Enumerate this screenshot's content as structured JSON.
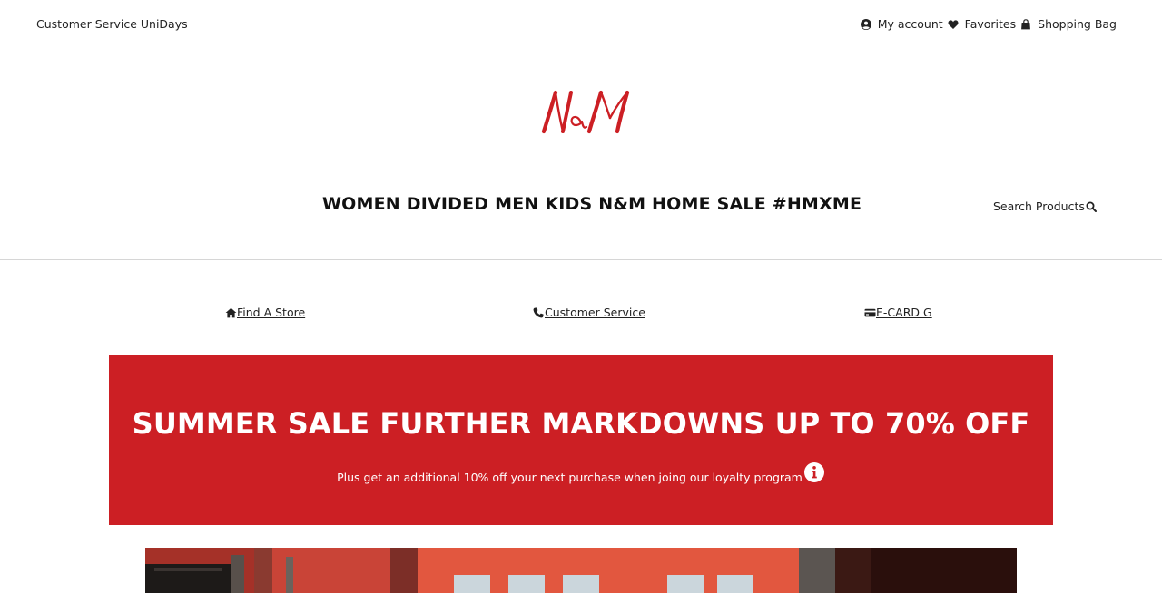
{
  "topbar": {
    "left_links": [
      "Customer Service",
      "UniDays"
    ],
    "right_links": [
      {
        "label": "My account",
        "icon": "user-circle-icon"
      },
      {
        "label": "Favorites",
        "icon": "heart-icon"
      },
      {
        "label": "Shopping Bag",
        "icon": "shopping-bag-icon"
      }
    ]
  },
  "logo": {
    "text": "N&M",
    "color": "#cc1f24"
  },
  "nav": {
    "items": [
      "WOMEN",
      "DIVIDED",
      "MEN",
      "KIDS",
      "N&M HOME",
      "SALE",
      "#HMXME"
    ],
    "search_label": "Search Products"
  },
  "utility": {
    "find_store": "Find A Store",
    "customer_service": "Customer Service",
    "ecard": "E-CARD G"
  },
  "promo": {
    "title": "SUMMER SALE FURTHER MARKDOWNS UP TO 70% OFF",
    "subtitle": "Plus get an additional 10% off your next purchase when joing our loyalty program",
    "background": "#cc1f24"
  },
  "colors": {
    "accent": "#cc1f24",
    "text": "#222222"
  }
}
